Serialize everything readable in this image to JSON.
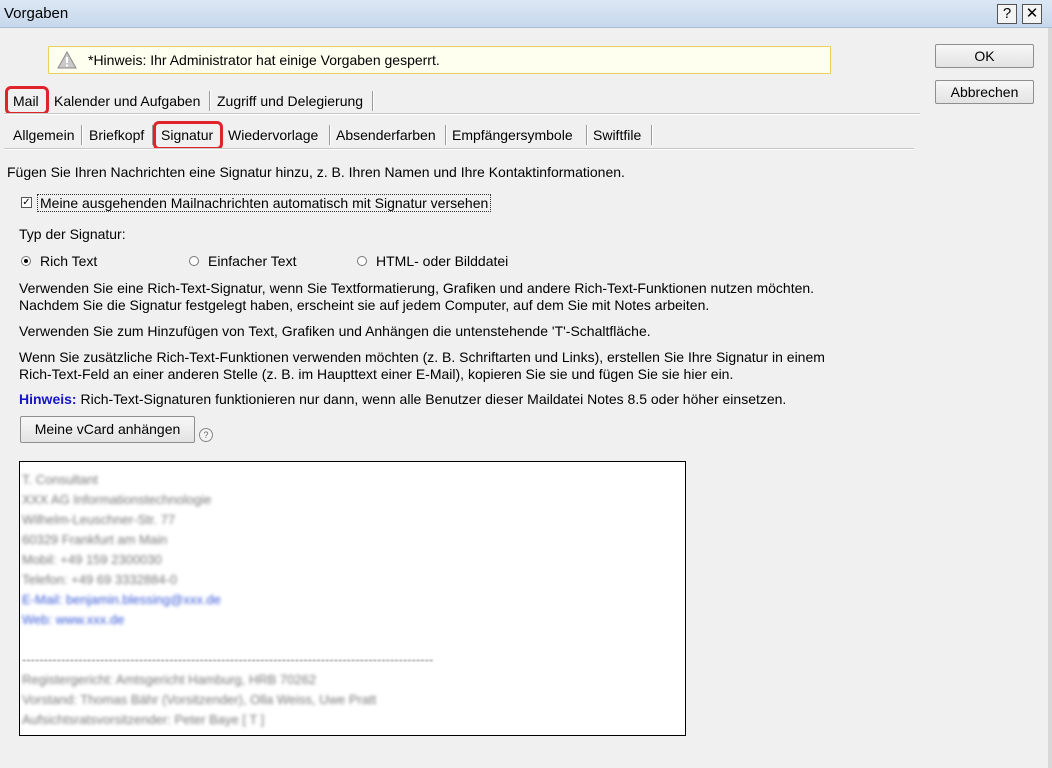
{
  "window": {
    "title": "Vorgaben",
    "help_label": "?",
    "close_label": "✕"
  },
  "notice": {
    "icon": "warning-icon",
    "text": "*Hinweis: Ihr Administrator hat einige Vorgaben gesperrt."
  },
  "buttons": {
    "ok": "OK",
    "cancel": "Abbrechen"
  },
  "main_tabs": [
    "Mail",
    "Kalender und Aufgaben",
    "Zugriff und Delegierung"
  ],
  "sub_tabs": [
    "Allgemein",
    "Briefkopf",
    "Signatur",
    "Wiedervorlage",
    "Absenderfarben",
    "Empfängersymbole",
    "Swiftfile"
  ],
  "selected": {
    "main_tab": "Mail",
    "sub_tab": "Signatur"
  },
  "content": {
    "intro": "Fügen Sie Ihren Nachrichten eine Signatur hinzu, z. B. Ihren Namen und Ihre Kontaktinformationen.",
    "auto_signature_label": "Meine ausgehenden Mailnachrichten automatisch mit Signatur versehen",
    "auto_signature_checked": true,
    "type_label": "Typ der Signatur:",
    "types": [
      "Rich Text",
      "Einfacher Text",
      "HTML- oder Bilddatei"
    ],
    "selected_type": "Rich Text",
    "para1_line1": "Verwenden Sie eine Rich-Text-Signatur, wenn Sie Textformatierung, Grafiken und andere Rich-Text-Funktionen nutzen möchten.",
    "para1_line2": "Nachdem Sie die Signatur festgelegt haben, erscheint sie auf jedem Computer, auf dem Sie mit Notes arbeiten.",
    "para2": "Verwenden Sie zum Hinzufügen von Text, Grafiken und Anhängen die untenstehende 'T'-Schaltfläche.",
    "para3_line1": "Wenn Sie zusätzliche Rich-Text-Funktionen verwenden möchten (z. B. Schriftarten und Links), erstellen Sie Ihre Signatur in einem",
    "para3_line2": "Rich-Text-Feld an einer anderen Stelle (z. B. im Haupttext einer E-Mail), kopieren Sie sie und fügen Sie sie hier ein.",
    "hint_label": "Hinweis:",
    "hint_text": " Rich-Text-Signaturen funktionieren nur dann, wenn alle Benutzer dieser Maildatei Notes 8.5 oder höher einsetzen.",
    "vcard_button": "Meine vCard anhängen",
    "help_icon": "question-icon",
    "hint_color": "#1515c8"
  },
  "signature_preview": {
    "blurred": true,
    "lines": [
      "T. Consultant",
      "XXX  AG  Informationstechnologie",
      "Wilhelm-Leuschner-Str.  77",
      "60329  Frankfurt am Main",
      "Mobil:  +49  159  2300030",
      "Telefon:  +49  69  3332884-0",
      "E-Mail:  benjamin.blessing@xxx.de",
      "Web:  www.xxx.de",
      "-----------------------------------------------------------------------------------------------",
      "Registergericht: Amtsgericht Hamburg,  HRB 70262",
      "Vorstand: Thomas Bähr (Vorsitzender), Olla Weiss, Uwe Pratt",
      "Aufsichtsratsvorsitzender: Peter Baye  [ T ]"
    ]
  }
}
